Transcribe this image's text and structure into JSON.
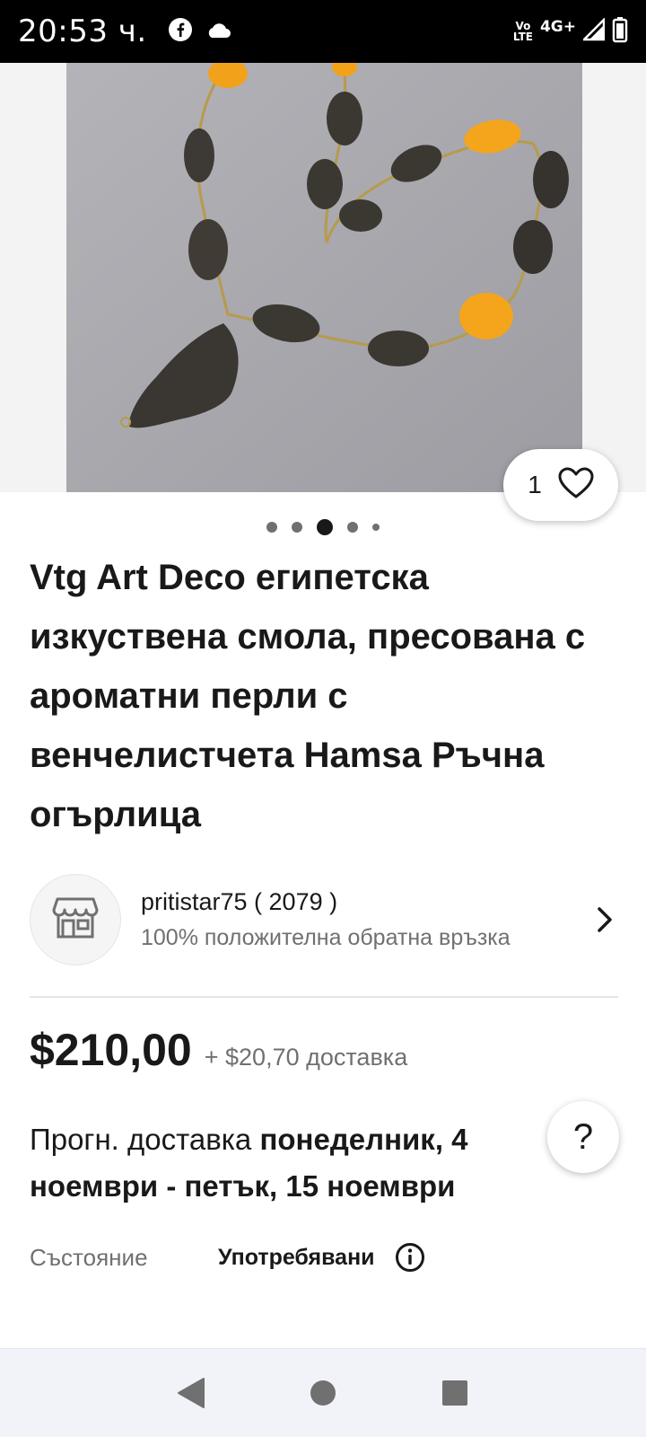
{
  "status_bar": {
    "time": "20:53 ч.",
    "volte_label_top": "Vo",
    "volte_label_bottom": "LTE",
    "network": "4G+",
    "icons": [
      "facebook-icon",
      "cloud-icon",
      "volte-icon",
      "signal-icon",
      "battery-icon"
    ]
  },
  "gallery": {
    "image_count": 5,
    "active_index": 2,
    "favorite_count": "1"
  },
  "listing": {
    "title": "Vtg Art Deco египетска изкуствена смола, пресована с ароматни перли с венчелистчета Hamsa Ръчна огърлица"
  },
  "seller": {
    "name": "pritistar75 ( 2079 )",
    "feedback": "100% положителна обратна връзка"
  },
  "pricing": {
    "price": "$210,00",
    "shipping": "+ $20,70 доставка"
  },
  "delivery": {
    "prefix": "Прогн. доставка ",
    "range": "понеделник, 4 ноември - петък, 15 ноември"
  },
  "help": {
    "label": "?"
  },
  "condition": {
    "label": "Състояние",
    "value": "Употребявани"
  },
  "colors": {
    "text_primary": "#191919",
    "text_secondary": "#707070",
    "status_bar": "#000000",
    "nav_bar": "#f1f3f9"
  }
}
